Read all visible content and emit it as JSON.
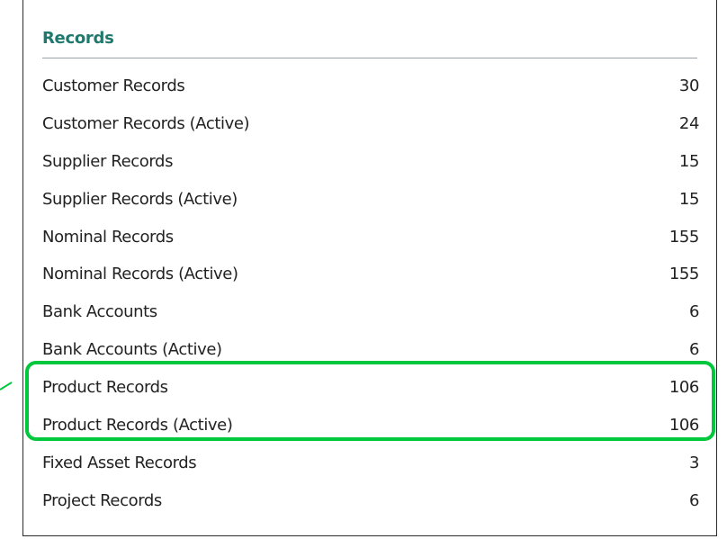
{
  "records": {
    "title": "Records",
    "title_color": "#1f7a6d",
    "highlight_color": "#00c83c",
    "items": [
      {
        "label": "Customer Records",
        "value": "30"
      },
      {
        "label": "Customer Records (Active)",
        "value": "24"
      },
      {
        "label": "Supplier Records",
        "value": "15"
      },
      {
        "label": "Supplier Records (Active)",
        "value": "15"
      },
      {
        "label": "Nominal Records",
        "value": "155"
      },
      {
        "label": "Nominal Records (Active)",
        "value": "155"
      },
      {
        "label": "Bank Accounts",
        "value": "6"
      },
      {
        "label": "Bank Accounts (Active)",
        "value": "6"
      },
      {
        "label": "Product Records",
        "value": "106"
      },
      {
        "label": "Product Records (Active)",
        "value": "106"
      },
      {
        "label": "Fixed Asset Records",
        "value": "3"
      },
      {
        "label": "Project Records",
        "value": "6"
      }
    ]
  }
}
